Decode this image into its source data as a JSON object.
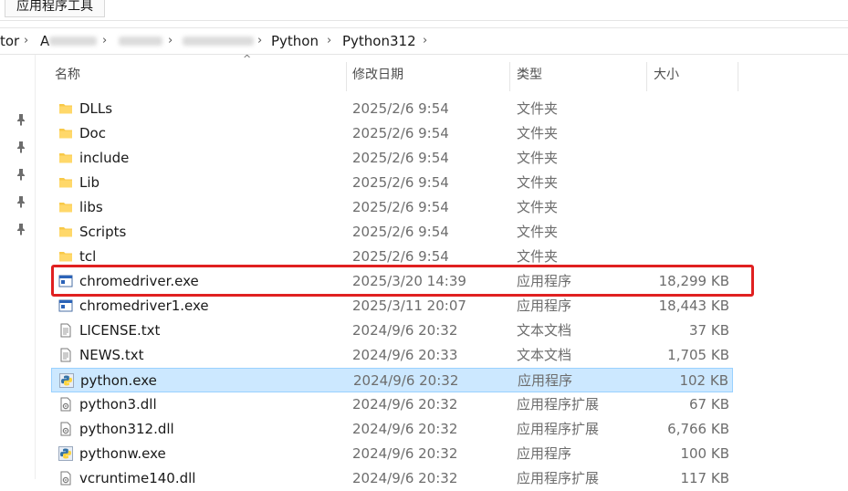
{
  "ribbon": {
    "tab_label": "应用程序工具"
  },
  "breadcrumb": {
    "prefix": "tor",
    "obscured_1": "A",
    "current_parent": "Python",
    "current": "Python312"
  },
  "columns": {
    "name": "名称",
    "date": "修改日期",
    "type": "类型",
    "size": "大小"
  },
  "files": [
    {
      "name": "DLLs",
      "date": "2025/2/6 9:54",
      "type": "文件夹",
      "size": "",
      "icon": "folder-icon"
    },
    {
      "name": "Doc",
      "date": "2025/2/6 9:54",
      "type": "文件夹",
      "size": "",
      "icon": "folder-icon"
    },
    {
      "name": "include",
      "date": "2025/2/6 9:54",
      "type": "文件夹",
      "size": "",
      "icon": "folder-icon"
    },
    {
      "name": "Lib",
      "date": "2025/2/6 9:54",
      "type": "文件夹",
      "size": "",
      "icon": "folder-icon"
    },
    {
      "name": "libs",
      "date": "2025/2/6 9:54",
      "type": "文件夹",
      "size": "",
      "icon": "folder-icon"
    },
    {
      "name": "Scripts",
      "date": "2025/2/6 9:54",
      "type": "文件夹",
      "size": "",
      "icon": "folder-icon"
    },
    {
      "name": "tcl",
      "date": "2025/2/6 9:54",
      "type": "文件夹",
      "size": "",
      "icon": "folder-icon"
    },
    {
      "name": "chromedriver.exe",
      "date": "2025/3/20 14:39",
      "type": "应用程序",
      "size": "18,299 KB",
      "icon": "app-window-icon"
    },
    {
      "name": "chromedriver1.exe",
      "date": "2025/3/11 20:07",
      "type": "应用程序",
      "size": "18,443 KB",
      "icon": "app-window-icon"
    },
    {
      "name": "LICENSE.txt",
      "date": "2024/9/6 20:32",
      "type": "文本文档",
      "size": "37 KB",
      "icon": "text-file-icon"
    },
    {
      "name": "NEWS.txt",
      "date": "2024/9/6 20:33",
      "type": "文本文档",
      "size": "1,705 KB",
      "icon": "text-file-icon"
    },
    {
      "name": "python.exe",
      "date": "2024/9/6 20:32",
      "type": "应用程序",
      "size": "102 KB",
      "icon": "python-icon"
    },
    {
      "name": "python3.dll",
      "date": "2024/9/6 20:32",
      "type": "应用程序扩展",
      "size": "67 KB",
      "icon": "dll-file-icon"
    },
    {
      "name": "python312.dll",
      "date": "2024/9/6 20:32",
      "type": "应用程序扩展",
      "size": "6,766 KB",
      "icon": "dll-file-icon"
    },
    {
      "name": "pythonw.exe",
      "date": "2024/9/6 20:32",
      "type": "应用程序",
      "size": "100 KB",
      "icon": "python-icon"
    },
    {
      "name": "vcruntime140.dll",
      "date": "2024/9/6 20:32",
      "type": "应用程序扩展",
      "size": "117 KB",
      "icon": "dll-file-icon"
    }
  ],
  "selected_file": "python.exe",
  "highlighted_file": "chromedriver.exe",
  "colors": {
    "selection_bg": "#cce8ff",
    "selection_border": "#99d1ff",
    "highlight_box": "#e02020",
    "folder_yellow": "#f8c948"
  }
}
